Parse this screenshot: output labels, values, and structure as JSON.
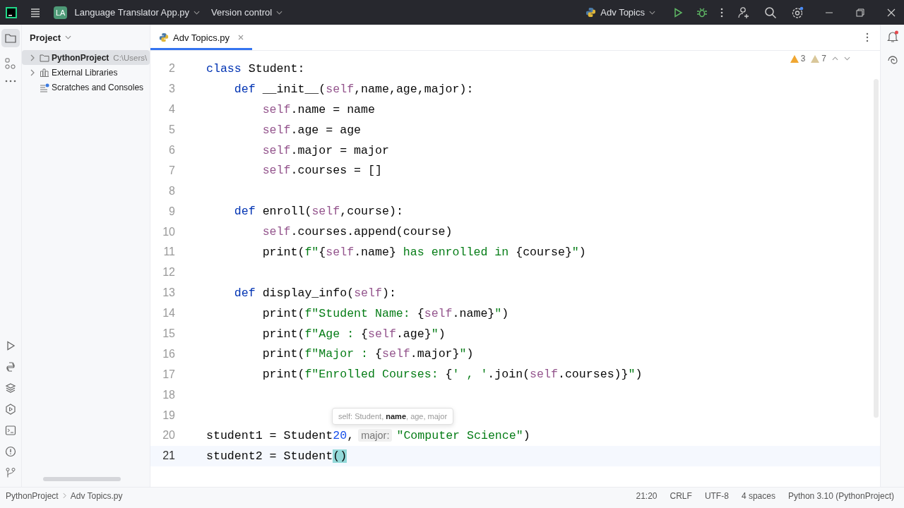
{
  "title_bar": {
    "project_badge": "LA",
    "project_name": "Language Translator App.py",
    "vcs": "Version control",
    "run_config": "Adv Topics"
  },
  "project_panel": {
    "title": "Project",
    "items": [
      {
        "kind": "folder",
        "label": "PythonProject",
        "detail": "C:\\Users\\",
        "expanded": false,
        "selected": true
      },
      {
        "kind": "library",
        "label": "External Libraries",
        "expanded": false,
        "selected": false
      },
      {
        "kind": "scratches",
        "label": "Scratches and Consoles",
        "selected": false
      }
    ]
  },
  "tabs": [
    {
      "label": "Adv Topics.py",
      "selected": true
    }
  ],
  "inspections": [
    {
      "kind": "warning",
      "count": "3"
    },
    {
      "kind": "weak",
      "count": "7"
    }
  ],
  "code": {
    "lines": [
      {
        "number": "2",
        "current": false,
        "tokens": [
          {
            "kind": "kw",
            "text": "class"
          },
          {
            "kind": "plain",
            "text": " Student:"
          }
        ],
        "children": [
          {
            "number": "3",
            "current": false,
            "tokens": [
              {
                "kind": "kw",
                "text": "def"
              },
              {
                "kind": "fn",
                "text": "__init__"
              },
              {
                "kind": "plain",
                "text": "("
              },
              {
                "kind": "self",
                "text": "self"
              },
              {
                "kind": "plain",
                "text": ",name,age,major):"
              }
            ],
            "children": [
              {
                "number": "4",
                "current": false,
                "tokens": [
                  {
                    "kind": "self",
                    "text": "self"
                  },
                  {
                    "kind": "plain",
                    "text": ".name = name"
                  }
                ]
              },
              {
                "number": "5",
                "current": false,
                "tokens": [
                  {
                    "kind": "self",
                    "text": "self"
                  },
                  {
                    "kind": "plain",
                    "text": ".age = age"
                  }
                ]
              },
              {
                "number": "6",
                "current": false,
                "tokens": [
                  {
                    "kind": "self",
                    "text": "self"
                  },
                  {
                    "kind": "plain",
                    "text": ".major = major"
                  }
                ]
              },
              {
                "number": "7",
                "current": false,
                "tokens": [
                  {
                    "kind": "self",
                    "text": "self"
                  },
                  {
                    "kind": "plain",
                    "text": ".courses = []"
                  }
                ]
              }
            ]
          },
          {
            "number": "8",
            "current": false
          },
          {
            "number": "9",
            "current": false,
            "tokens": [
              {
                "kind": "kw",
                "text": "def"
              },
              {
                "kind": "fn",
                "text": "enroll"
              },
              {
                "kind": "plain",
                "text": "("
              },
              {
                "kind": "self",
                "text": "self"
              },
              {
                "kind": "plain",
                "text": ",course):"
              }
            ],
            "children": [
              {
                "number": "10",
                "current": false,
                "tokens": [
                  {
                    "kind": "self",
                    "text": "self"
                  },
                  {
                    "kind": "plain",
                    "text": ".courses.append(course)"
                  }
                ]
              },
              {
                "number": "11",
                "current": false,
                "tokens": [
                  {
                    "kind": "plain",
                    "text": "print("
                  },
                  {
                    "kind": "str",
                    "text": "f\""
                  },
                  {
                    "kind": "plain",
                    "text": "{"
                  },
                  {
                    "kind": "self",
                    "text": "self"
                  },
                  {
                    "kind": "plain",
                    "text": ".name}"
                  },
                  {
                    "kind": "str",
                    "text": " has enrolled in "
                  },
                  {
                    "kind": "plain",
                    "text": "{course}"
                  },
                  {
                    "kind": "str",
                    "text": "\""
                  },
                  {
                    "kind": "plain",
                    "text": ")"
                  }
                ]
              }
            ]
          },
          {
            "number": "12",
            "current": false
          },
          {
            "number": "13",
            "current": false,
            "tokens": [
              {
                "kind": "kw",
                "text": "def"
              },
              {
                "kind": "fn",
                "text": "display_info"
              },
              {
                "kind": "plain",
                "text": "("
              },
              {
                "kind": "self",
                "text": "self"
              },
              {
                "kind": "plain",
                "text": "):"
              }
            ],
            "children": [
              {
                "number": "14",
                "current": false,
                "tokens": [
                  {
                    "kind": "plain",
                    "text": "print("
                  },
                  {
                    "kind": "str",
                    "text": "f\"Student Name: "
                  },
                  {
                    "kind": "plain",
                    "text": "{"
                  },
                  {
                    "kind": "self",
                    "text": "self"
                  },
                  {
                    "kind": "plain",
                    "text": ".name}"
                  },
                  {
                    "kind": "str",
                    "text": "\""
                  },
                  {
                    "kind": "plain",
                    "text": ")"
                  }
                ]
              },
              {
                "number": "15",
                "current": false,
                "tokens": [
                  {
                    "kind": "plain",
                    "text": "print("
                  },
                  {
                    "kind": "str",
                    "text": "f\"Age : "
                  },
                  {
                    "kind": "plain",
                    "text": "{"
                  },
                  {
                    "kind": "self",
                    "text": "self"
                  },
                  {
                    "kind": "plain",
                    "text": ".age}"
                  },
                  {
                    "kind": "str",
                    "text": "\""
                  },
                  {
                    "kind": "plain",
                    "text": ")"
                  }
                ]
              },
              {
                "number": "16",
                "current": false,
                "tokens": [
                  {
                    "kind": "plain",
                    "text": "print("
                  },
                  {
                    "kind": "str",
                    "text": "f\"Major : "
                  },
                  {
                    "kind": "plain",
                    "text": "{"
                  },
                  {
                    "kind": "self",
                    "text": "self"
                  },
                  {
                    "kind": "plain",
                    "text": ".major}"
                  },
                  {
                    "kind": "str",
                    "text": "\""
                  },
                  {
                    "kind": "plain",
                    "text": ")"
                  }
                ]
              },
              {
                "number": "17",
                "current": false,
                "tokens": [
                  {
                    "kind": "plain",
                    "text": "print("
                  },
                  {
                    "kind": "str",
                    "text": "f\"Enrolled Courses: "
                  },
                  {
                    "kind": "plain",
                    "text": "{"
                  },
                  {
                    "kind": "str",
                    "text": "' , '"
                  },
                  {
                    "kind": "plain",
                    "text": ".join("
                  },
                  {
                    "kind": "self",
                    "text": "self"
                  },
                  {
                    "kind": "plain",
                    "text": ".courses)}"
                  },
                  {
                    "kind": "str",
                    "text": "\""
                  },
                  {
                    "kind": "plain",
                    "text": ")"
                  }
                ]
              }
            ]
          }
        ]
      },
      {
        "number": "18",
        "current": false
      },
      {
        "number": "19",
        "current": false
      },
      {
        "number": "20",
        "current": false,
        "tokens": [
          {
            "kind": "plain",
            "text": "student1 = Student"
          },
          {
            "kind": "num",
            "text": "20"
          },
          {
            "kind": "plain",
            "text": ","
          },
          {
            "kind": "hint",
            "text": "major:"
          },
          {
            "kind": "str",
            "text": "\"Computer Science\""
          },
          {
            "kind": "plain",
            "text": ")"
          }
        ]
      },
      {
        "number": "21",
        "current": true,
        "tokens": [
          {
            "kind": "plain",
            "text": "student2 = Student"
          },
          {
            "kind": "match",
            "text": "()"
          }
        ]
      }
    ],
    "tooltip": "self: Student, **name**, age, major"
  },
  "status_bar": {
    "breadcrumbs": [
      "PythonProject",
      "Adv Topics.py"
    ],
    "items": [
      "21:20",
      "CRLF",
      "UTF-8",
      "4 spaces",
      "Python 3.10 (PythonProject)"
    ]
  }
}
